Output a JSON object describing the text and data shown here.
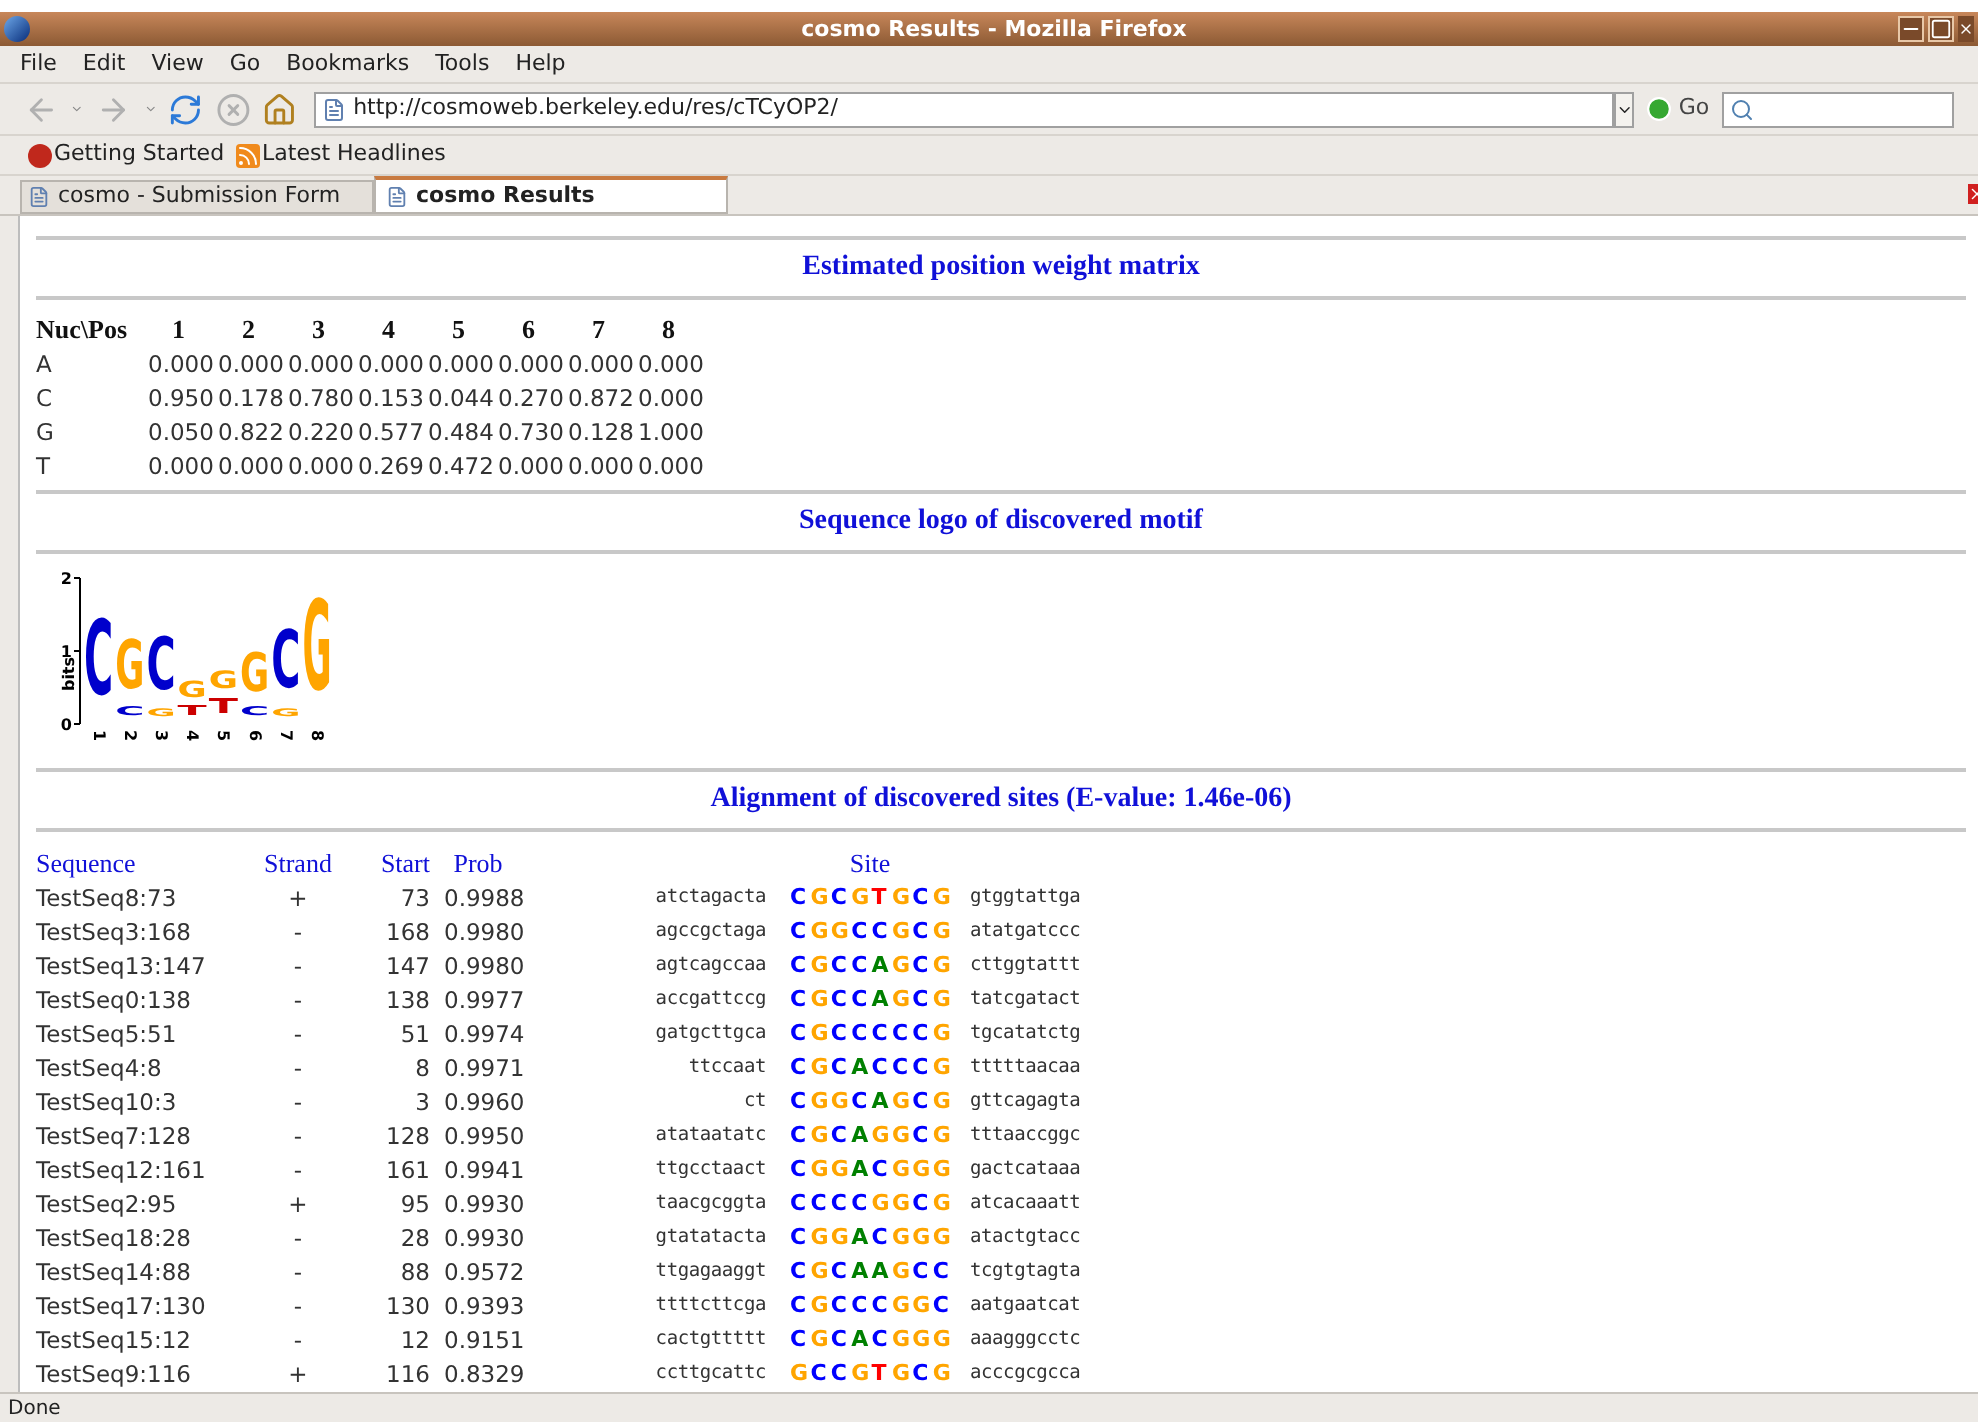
{
  "window": {
    "title": "cosmo Results - Mozilla Firefox"
  },
  "menu": [
    "File",
    "Edit",
    "View",
    "Go",
    "Bookmarks",
    "Tools",
    "Help"
  ],
  "address": {
    "value": "http://cosmoweb.berkeley.edu/res/cTCyOP2/"
  },
  "go_button": "Go",
  "bookmarks": [
    {
      "label": "Getting Started",
      "kind": "firefox"
    },
    {
      "label": "Latest Headlines",
      "kind": "feed"
    }
  ],
  "tabs": [
    {
      "label": "cosmo - Submission Form",
      "selected": false
    },
    {
      "label": "cosmo Results",
      "selected": true
    }
  ],
  "pwm": {
    "title": "Estimated position weight matrix",
    "header": [
      "Nuc\\Pos",
      "1",
      "2",
      "3",
      "4",
      "5",
      "6",
      "7",
      "8"
    ],
    "rows": [
      [
        "A",
        "0.000",
        "0.000",
        "0.000",
        "0.000",
        "0.000",
        "0.000",
        "0.000",
        "0.000"
      ],
      [
        "C",
        "0.950",
        "0.178",
        "0.780",
        "0.153",
        "0.044",
        "0.270",
        "0.872",
        "0.000"
      ],
      [
        "G",
        "0.050",
        "0.822",
        "0.220",
        "0.577",
        "0.484",
        "0.730",
        "0.128",
        "1.000"
      ],
      [
        "T",
        "0.000",
        "0.000",
        "0.000",
        "0.269",
        "0.472",
        "0.000",
        "0.000",
        "0.000"
      ]
    ]
  },
  "logo": {
    "title": "Sequence logo of discovered motif",
    "ylabel": "bits",
    "yticks": [
      "2",
      "1",
      "0"
    ],
    "positions": [
      {
        "label": "1",
        "letters": [
          {
            "base": "C",
            "color": "#0000cc"
          }
        ]
      },
      {
        "label": "2",
        "letters": [
          {
            "base": "G",
            "color": "#ffa500"
          },
          {
            "base": "C",
            "color": "#0000cc"
          }
        ]
      },
      {
        "label": "3",
        "letters": [
          {
            "base": "C",
            "color": "#0000cc"
          },
          {
            "base": "G",
            "color": "#ffa500"
          }
        ]
      },
      {
        "label": "4",
        "letters": [
          {
            "base": "G",
            "color": "#ffa500"
          },
          {
            "base": "T",
            "color": "#cc0000"
          }
        ]
      },
      {
        "label": "5",
        "letters": [
          {
            "base": "G",
            "color": "#ffa500"
          },
          {
            "base": "T",
            "color": "#cc0000"
          }
        ]
      },
      {
        "label": "6",
        "letters": [
          {
            "base": "G",
            "color": "#ffa500"
          },
          {
            "base": "C",
            "color": "#0000cc"
          }
        ]
      },
      {
        "label": "7",
        "letters": [
          {
            "base": "C",
            "color": "#0000cc"
          },
          {
            "base": "G",
            "color": "#ffa500"
          }
        ]
      },
      {
        "label": "8",
        "letters": [
          {
            "base": "G",
            "color": "#ffa500"
          }
        ]
      }
    ]
  },
  "alignment": {
    "title": "Alignment of discovered sites (E-value: 1.46e-06)",
    "columns": [
      "Sequence",
      "Strand",
      "Start",
      "Prob",
      "Site"
    ],
    "rows": [
      {
        "sequence": "TestSeq8:73",
        "strand": "+",
        "start": "73",
        "prob": "0.9988",
        "left": "atctagacta",
        "site": [
          {
            "base": "C",
            "color": "#0000ff"
          },
          {
            "base": "G",
            "color": "#ffa500"
          },
          {
            "base": "C",
            "color": "#0000ff"
          },
          {
            "base": "G",
            "color": "#ffa500"
          },
          {
            "base": "T",
            "color": "#ff0000"
          },
          {
            "base": "G",
            "color": "#ffa500"
          },
          {
            "base": "C",
            "color": "#0000ff"
          },
          {
            "base": "G",
            "color": "#ffa500"
          }
        ],
        "right": "gtggtattga"
      },
      {
        "sequence": "TestSeq3:168",
        "strand": "-",
        "start": "168",
        "prob": "0.9980",
        "left": "agccgctaga",
        "site": [
          {
            "base": "C",
            "color": "#0000ff"
          },
          {
            "base": "G",
            "color": "#ffa500"
          },
          {
            "base": "G",
            "color": "#ffa500"
          },
          {
            "base": "C",
            "color": "#0000ff"
          },
          {
            "base": "C",
            "color": "#0000ff"
          },
          {
            "base": "G",
            "color": "#ffa500"
          },
          {
            "base": "C",
            "color": "#0000ff"
          },
          {
            "base": "G",
            "color": "#ffa500"
          }
        ],
        "right": "atatgatccc"
      },
      {
        "sequence": "TestSeq13:147",
        "strand": "-",
        "start": "147",
        "prob": "0.9980",
        "left": "agtcagccaa",
        "site": [
          {
            "base": "C",
            "color": "#0000ff"
          },
          {
            "base": "G",
            "color": "#ffa500"
          },
          {
            "base": "C",
            "color": "#0000ff"
          },
          {
            "base": "C",
            "color": "#0000ff"
          },
          {
            "base": "A",
            "color": "#008000"
          },
          {
            "base": "G",
            "color": "#ffa500"
          },
          {
            "base": "C",
            "color": "#0000ff"
          },
          {
            "base": "G",
            "color": "#ffa500"
          }
        ],
        "right": "cttggtattt"
      },
      {
        "sequence": "TestSeq0:138",
        "strand": "-",
        "start": "138",
        "prob": "0.9977",
        "left": "accgattccg",
        "site": [
          {
            "base": "C",
            "color": "#0000ff"
          },
          {
            "base": "G",
            "color": "#ffa500"
          },
          {
            "base": "C",
            "color": "#0000ff"
          },
          {
            "base": "C",
            "color": "#0000ff"
          },
          {
            "base": "A",
            "color": "#008000"
          },
          {
            "base": "G",
            "color": "#ffa500"
          },
          {
            "base": "C",
            "color": "#0000ff"
          },
          {
            "base": "G",
            "color": "#ffa500"
          }
        ],
        "right": "tatcgatact"
      },
      {
        "sequence": "TestSeq5:51",
        "strand": "-",
        "start": "51",
        "prob": "0.9974",
        "left": "gatgcttgca",
        "site": [
          {
            "base": "C",
            "color": "#0000ff"
          },
          {
            "base": "G",
            "color": "#ffa500"
          },
          {
            "base": "C",
            "color": "#0000ff"
          },
          {
            "base": "C",
            "color": "#0000ff"
          },
          {
            "base": "C",
            "color": "#0000ff"
          },
          {
            "base": "C",
            "color": "#0000ff"
          },
          {
            "base": "C",
            "color": "#0000ff"
          },
          {
            "base": "G",
            "color": "#ffa500"
          }
        ],
        "right": "tgcatatctg"
      },
      {
        "sequence": "TestSeq4:8",
        "strand": "-",
        "start": "8",
        "prob": "0.9971",
        "left": "ttccaat",
        "site": [
          {
            "base": "C",
            "color": "#0000ff"
          },
          {
            "base": "G",
            "color": "#ffa500"
          },
          {
            "base": "C",
            "color": "#0000ff"
          },
          {
            "base": "A",
            "color": "#008000"
          },
          {
            "base": "C",
            "color": "#0000ff"
          },
          {
            "base": "C",
            "color": "#0000ff"
          },
          {
            "base": "C",
            "color": "#0000ff"
          },
          {
            "base": "G",
            "color": "#ffa500"
          }
        ],
        "right": "tttttaacaa"
      },
      {
        "sequence": "TestSeq10:3",
        "strand": "-",
        "start": "3",
        "prob": "0.9960",
        "left": "ct",
        "site": [
          {
            "base": "C",
            "color": "#0000ff"
          },
          {
            "base": "G",
            "color": "#ffa500"
          },
          {
            "base": "G",
            "color": "#ffa500"
          },
          {
            "base": "C",
            "color": "#0000ff"
          },
          {
            "base": "A",
            "color": "#008000"
          },
          {
            "base": "G",
            "color": "#ffa500"
          },
          {
            "base": "C",
            "color": "#0000ff"
          },
          {
            "base": "G",
            "color": "#ffa500"
          }
        ],
        "right": "gttcagagta"
      },
      {
        "sequence": "TestSeq7:128",
        "strand": "-",
        "start": "128",
        "prob": "0.9950",
        "left": "atataatatc",
        "site": [
          {
            "base": "C",
            "color": "#0000ff"
          },
          {
            "base": "G",
            "color": "#ffa500"
          },
          {
            "base": "C",
            "color": "#0000ff"
          },
          {
            "base": "A",
            "color": "#008000"
          },
          {
            "base": "G",
            "color": "#ffa500"
          },
          {
            "base": "G",
            "color": "#ffa500"
          },
          {
            "base": "C",
            "color": "#0000ff"
          },
          {
            "base": "G",
            "color": "#ffa500"
          }
        ],
        "right": "tttaaccggc"
      },
      {
        "sequence": "TestSeq12:161",
        "strand": "-",
        "start": "161",
        "prob": "0.9941",
        "left": "ttgcctaact",
        "site": [
          {
            "base": "C",
            "color": "#0000ff"
          },
          {
            "base": "G",
            "color": "#ffa500"
          },
          {
            "base": "G",
            "color": "#ffa500"
          },
          {
            "base": "A",
            "color": "#008000"
          },
          {
            "base": "C",
            "color": "#0000ff"
          },
          {
            "base": "G",
            "color": "#ffa500"
          },
          {
            "base": "G",
            "color": "#ffa500"
          },
          {
            "base": "G",
            "color": "#ffa500"
          }
        ],
        "right": "gactcataaa"
      },
      {
        "sequence": "TestSeq2:95",
        "strand": "+",
        "start": "95",
        "prob": "0.9930",
        "left": "taacgcggta",
        "site": [
          {
            "base": "C",
            "color": "#0000ff"
          },
          {
            "base": "C",
            "color": "#0000ff"
          },
          {
            "base": "C",
            "color": "#0000ff"
          },
          {
            "base": "C",
            "color": "#0000ff"
          },
          {
            "base": "G",
            "color": "#ffa500"
          },
          {
            "base": "G",
            "color": "#ffa500"
          },
          {
            "base": "C",
            "color": "#0000ff"
          },
          {
            "base": "G",
            "color": "#ffa500"
          }
        ],
        "right": "atcacaaatt"
      },
      {
        "sequence": "TestSeq18:28",
        "strand": "-",
        "start": "28",
        "prob": "0.9930",
        "left": "gtatatacta",
        "site": [
          {
            "base": "C",
            "color": "#0000ff"
          },
          {
            "base": "G",
            "color": "#ffa500"
          },
          {
            "base": "G",
            "color": "#ffa500"
          },
          {
            "base": "A",
            "color": "#008000"
          },
          {
            "base": "C",
            "color": "#0000ff"
          },
          {
            "base": "G",
            "color": "#ffa500"
          },
          {
            "base": "G",
            "color": "#ffa500"
          },
          {
            "base": "G",
            "color": "#ffa500"
          }
        ],
        "right": "atactgtacc"
      },
      {
        "sequence": "TestSeq14:88",
        "strand": "-",
        "start": "88",
        "prob": "0.9572",
        "left": "ttgagaaggt",
        "site": [
          {
            "base": "C",
            "color": "#0000ff"
          },
          {
            "base": "G",
            "color": "#ffa500"
          },
          {
            "base": "C",
            "color": "#0000ff"
          },
          {
            "base": "A",
            "color": "#008000"
          },
          {
            "base": "A",
            "color": "#008000"
          },
          {
            "base": "G",
            "color": "#ffa500"
          },
          {
            "base": "C",
            "color": "#0000ff"
          },
          {
            "base": "C",
            "color": "#0000ff"
          }
        ],
        "right": "tcgtgtagta"
      },
      {
        "sequence": "TestSeq17:130",
        "strand": "-",
        "start": "130",
        "prob": "0.9393",
        "left": "ttttcttcga",
        "site": [
          {
            "base": "C",
            "color": "#0000ff"
          },
          {
            "base": "G",
            "color": "#ffa500"
          },
          {
            "base": "C",
            "color": "#0000ff"
          },
          {
            "base": "C",
            "color": "#0000ff"
          },
          {
            "base": "C",
            "color": "#0000ff"
          },
          {
            "base": "G",
            "color": "#ffa500"
          },
          {
            "base": "G",
            "color": "#ffa500"
          },
          {
            "base": "C",
            "color": "#0000ff"
          }
        ],
        "right": "aatgaatcat"
      },
      {
        "sequence": "TestSeq15:12",
        "strand": "-",
        "start": "12",
        "prob": "0.9151",
        "left": "cactgttttt",
        "site": [
          {
            "base": "C",
            "color": "#0000ff"
          },
          {
            "base": "G",
            "color": "#ffa500"
          },
          {
            "base": "C",
            "color": "#0000ff"
          },
          {
            "base": "A",
            "color": "#008000"
          },
          {
            "base": "C",
            "color": "#0000ff"
          },
          {
            "base": "G",
            "color": "#ffa500"
          },
          {
            "base": "G",
            "color": "#ffa500"
          },
          {
            "base": "G",
            "color": "#ffa500"
          }
        ],
        "right": "aaagggcctc"
      },
      {
        "sequence": "TestSeq9:116",
        "strand": "+",
        "start": "116",
        "prob": "0.8329",
        "left": "ccttgcattc",
        "site": [
          {
            "base": "G",
            "color": "#ffa500"
          },
          {
            "base": "C",
            "color": "#0000ff"
          },
          {
            "base": "C",
            "color": "#0000ff"
          },
          {
            "base": "G",
            "color": "#ffa500"
          },
          {
            "base": "T",
            "color": "#ff0000"
          },
          {
            "base": "G",
            "color": "#ffa500"
          },
          {
            "base": "C",
            "color": "#0000ff"
          },
          {
            "base": "G",
            "color": "#ffa500"
          }
        ],
        "right": "acccgcgcca"
      }
    ]
  },
  "status_bar": "Done"
}
